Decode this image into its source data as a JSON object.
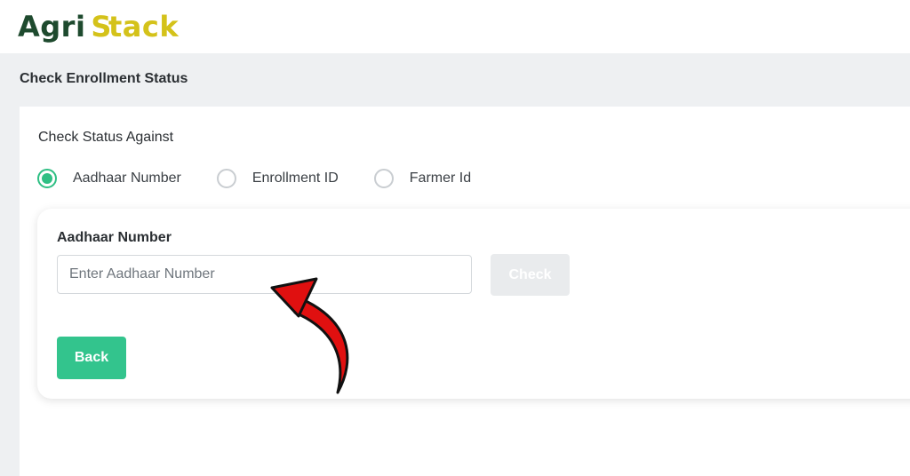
{
  "logo": {
    "agri": "Agri",
    "stack_s": "S",
    "stack_rest": "tack"
  },
  "page": {
    "title": "Check Enrollment Status"
  },
  "status": {
    "label": "Check Status Against",
    "options": [
      {
        "label": "Aadhaar Number",
        "selected": true
      },
      {
        "label": "Enrollment ID",
        "selected": false
      },
      {
        "label": "Farmer Id",
        "selected": false
      }
    ]
  },
  "form": {
    "field_label": "Aadhaar Number",
    "input_value": "",
    "input_placeholder": "Enter Aadhaar Number",
    "check_label": "Check",
    "back_label": "Back"
  },
  "colors": {
    "accent": "#33c48d",
    "logo_dark": "#1e4a2e",
    "logo_yellow": "#d4c21a",
    "annotation_arrow": "#e01010"
  },
  "icons": {
    "annotation": "curved-arrow-icon"
  }
}
